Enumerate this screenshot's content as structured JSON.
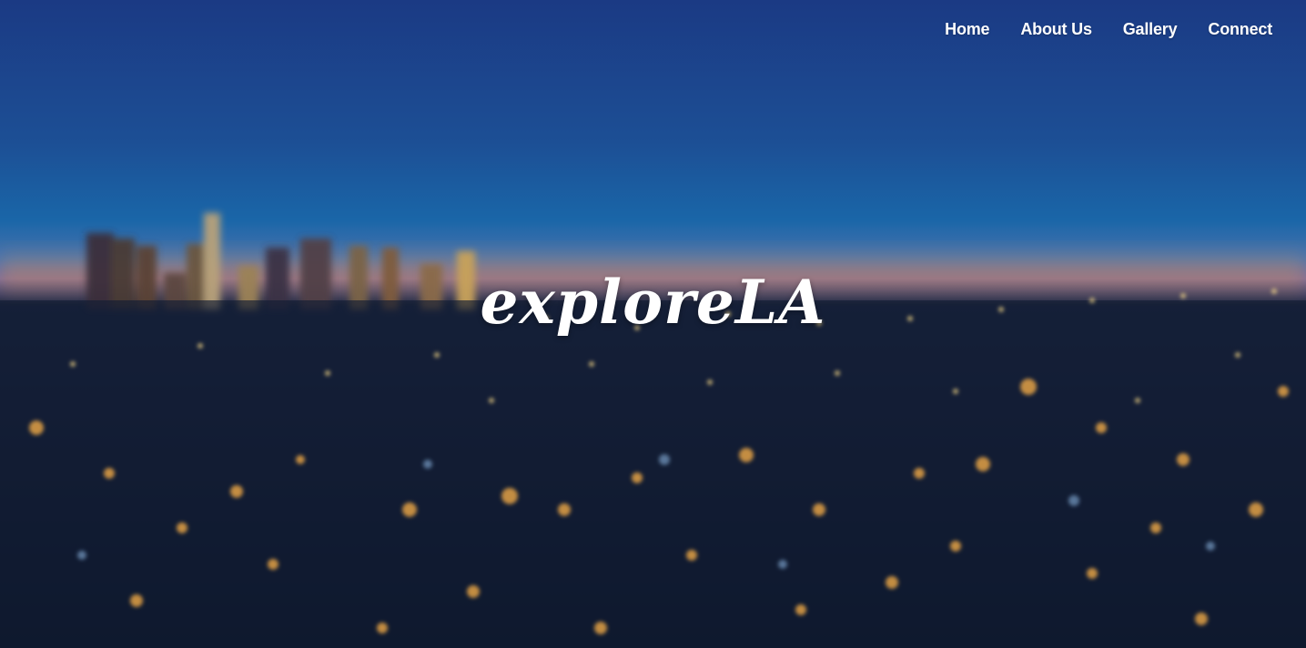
{
  "nav": {
    "items": [
      {
        "label": "Home"
      },
      {
        "label": "About Us"
      },
      {
        "label": "Gallery"
      },
      {
        "label": "Connect"
      }
    ]
  },
  "hero": {
    "title": "exploreLA"
  },
  "colors": {
    "sky_top": "#1d3f86",
    "sky_mid": "#1b5ea0",
    "horizon": "#3a6aa6",
    "city_dark": "#0e1a30",
    "lights_warm": "#ffb347",
    "text": "#ffffff"
  }
}
